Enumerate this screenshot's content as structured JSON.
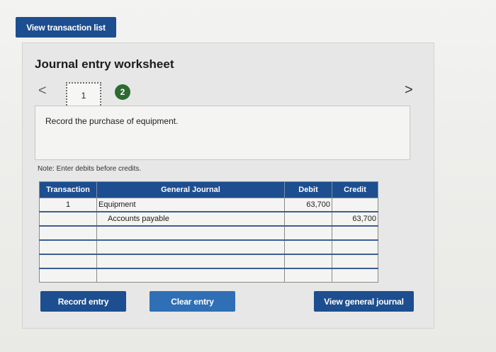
{
  "top": {
    "view_list_label": "View transaction list"
  },
  "worksheet": {
    "title": "Journal entry worksheet",
    "nav": {
      "prev": "<",
      "next": ">",
      "tabs": [
        "1",
        "2"
      ],
      "active_tab": "2"
    },
    "instruction": "Record the purchase of equipment.",
    "note": "Note: Enter debits before credits.",
    "table": {
      "headers": [
        "Transaction",
        "General Journal",
        "Debit",
        "Credit"
      ],
      "rows": [
        {
          "transaction": "1",
          "account": "Equipment",
          "debit": "63,700",
          "credit": ""
        },
        {
          "transaction": "",
          "account": "Accounts payable",
          "debit": "",
          "credit": "63,700"
        },
        {
          "transaction": "",
          "account": "",
          "debit": "",
          "credit": ""
        },
        {
          "transaction": "",
          "account": "",
          "debit": "",
          "credit": ""
        },
        {
          "transaction": "",
          "account": "",
          "debit": "",
          "credit": ""
        },
        {
          "transaction": "",
          "account": "",
          "debit": "",
          "credit": ""
        }
      ]
    },
    "buttons": {
      "record": "Record entry",
      "clear": "Clear entry",
      "view_general": "View general journal"
    }
  },
  "colors": {
    "primary_button": "#1d4e8f",
    "secondary_button": "#2f6fb5",
    "active_tab": "#2d6b30"
  }
}
